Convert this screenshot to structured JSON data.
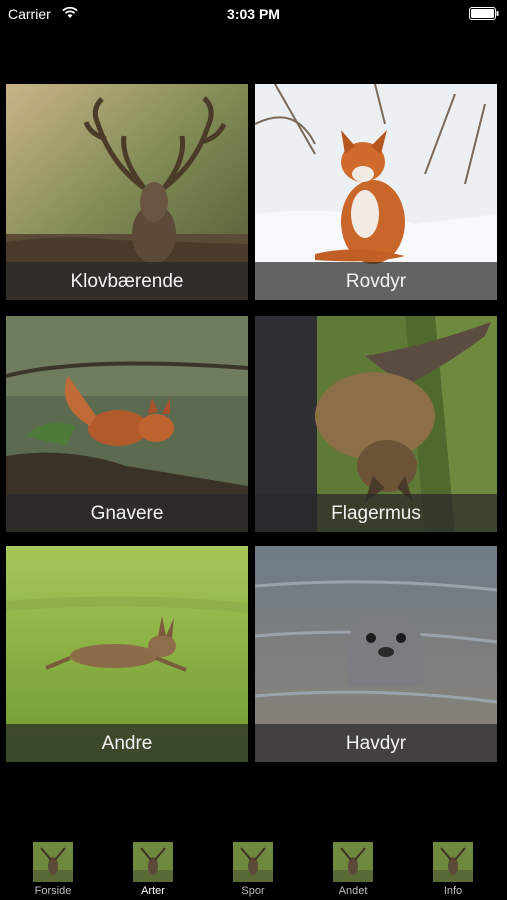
{
  "status_bar": {
    "carrier": "Carrier",
    "time": "3:03 PM"
  },
  "tiles": [
    {
      "label": "Klovbærende",
      "subject": "fallow-deer"
    },
    {
      "label": "Rovdyr",
      "subject": "red-fox"
    },
    {
      "label": "Gnavere",
      "subject": "red-squirrel"
    },
    {
      "label": "Flagermus",
      "subject": "bat"
    },
    {
      "label": "Andre",
      "subject": "hare"
    },
    {
      "label": "Havdyr",
      "subject": "seal"
    }
  ],
  "tabs": [
    {
      "label": "Forside",
      "icon": "deer-thumbnail-icon",
      "active": false
    },
    {
      "label": "Arter",
      "icon": "deer-thumbnail-icon",
      "active": true
    },
    {
      "label": "Spor",
      "icon": "deer-thumbnail-icon",
      "active": false
    },
    {
      "label": "Andet",
      "icon": "deer-thumbnail-icon",
      "active": false
    },
    {
      "label": "Info",
      "icon": "deer-thumbnail-icon",
      "active": false
    }
  ]
}
